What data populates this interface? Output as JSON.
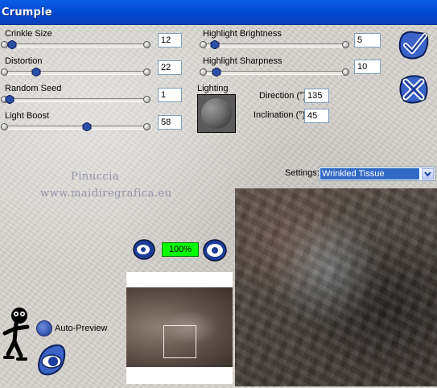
{
  "window": {
    "title": "Crumple"
  },
  "sliders": {
    "crinkle_size": {
      "label": "Crinkle Size",
      "value": "12",
      "level": 0.05
    },
    "distortion": {
      "label": "Distortion",
      "value": "22",
      "level": 0.2
    },
    "random_seed": {
      "label": "Random Seed",
      "value": "1",
      "level": 0.02
    },
    "light_boost": {
      "label": "Light Boost",
      "value": "58",
      "level": 0.58
    },
    "highlight_brightness": {
      "label": "Highlight Brightness",
      "value": "5",
      "level": 0.05
    },
    "highlight_sharpness": {
      "label": "Highlight Sharpness",
      "value": "10",
      "level": 0.1
    }
  },
  "lighting": {
    "label": "Lighting",
    "direction_label": "Direction (°)",
    "direction_value": "135",
    "inclination_label": "Inclination (°)",
    "inclination_value": "45"
  },
  "watermark": {
    "line1": "Pinuccia",
    "line2": "www.maidiregrafica.eu"
  },
  "settings": {
    "label": "Settings:",
    "selected": "Wrinkled Tissue"
  },
  "zoom": {
    "value": "100%"
  },
  "auto_preview": {
    "label": "Auto-Preview"
  },
  "icons": {
    "ok": "checkmark-icon",
    "cancel": "cancel-x-icon",
    "zoom_out": "zoom-out-icon",
    "zoom_in": "zoom-in-icon",
    "help": "help-figure-icon",
    "eye": "preview-eye-icon"
  },
  "colors": {
    "title_bar": "#0047cf",
    "zoom_box": "#00ff00",
    "selection": "#316ac5",
    "accent_blue": "#2c4fa8"
  }
}
